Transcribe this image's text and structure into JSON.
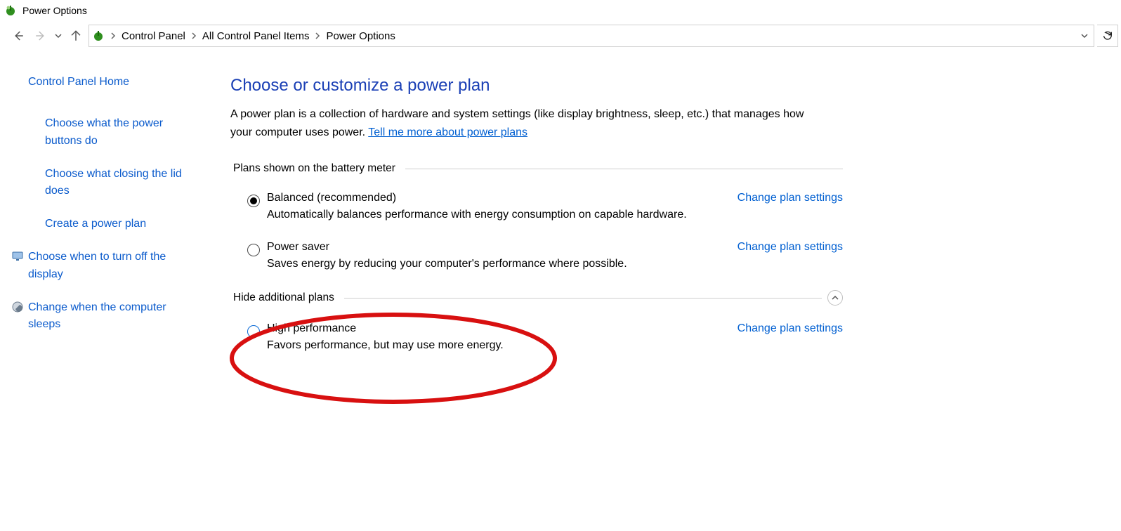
{
  "titlebar": {
    "app_title": "Power Options"
  },
  "breadcrumb": {
    "items": [
      "Control Panel",
      "All Control Panel Items",
      "Power Options"
    ]
  },
  "sidebar": {
    "home": "Control Panel Home",
    "items": [
      {
        "label": "Choose what the power buttons do",
        "icon": null
      },
      {
        "label": "Choose what closing the lid does",
        "icon": null
      },
      {
        "label": "Create a power plan",
        "icon": null
      },
      {
        "label": "Choose when to turn off the display",
        "icon": "display"
      },
      {
        "label": "Change when the computer sleeps",
        "icon": "sleep"
      }
    ]
  },
  "main": {
    "heading": "Choose or customize a power plan",
    "description_prefix": "A power plan is a collection of hardware and system settings (like display brightness, sleep, etc.) that manages how your computer uses power. ",
    "description_link": "Tell me more about power plans",
    "group1": "Plans shown on the battery meter",
    "group2": "Hide additional plans",
    "change_label": "Change plan settings",
    "plans_primary": [
      {
        "name": "Balanced (recommended)",
        "desc": "Automatically balances performance with energy consumption on capable hardware.",
        "selected": true
      },
      {
        "name": "Power saver",
        "desc": "Saves energy by reducing your computer's performance where possible.",
        "selected": false
      }
    ],
    "plans_additional": [
      {
        "name": "High performance",
        "desc": "Favors performance, but may use more energy.",
        "selected": false,
        "highlight": true
      }
    ]
  }
}
